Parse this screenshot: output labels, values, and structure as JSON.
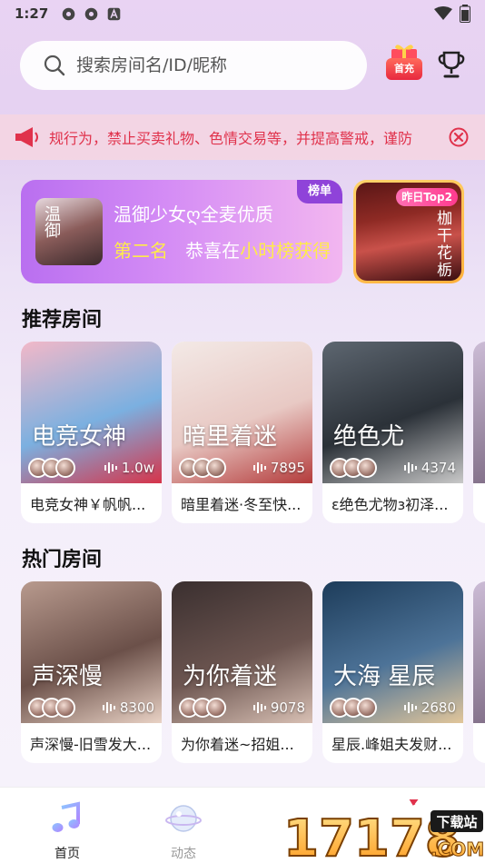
{
  "status": {
    "time": "1:27"
  },
  "search": {
    "placeholder": "搜索房间名/ID/昵称"
  },
  "header": {
    "first_recharge": "首充"
  },
  "notice": {
    "text": "规行为，禁止买卖礼物、色情交易等，并提高警戒，谨防"
  },
  "rank_banner": {
    "avatar_text": "温御",
    "line1": "温御少女ღ全麦优质",
    "line2_rank": "第二名",
    "line2_text": "恭喜在",
    "line2_highlight": "小时榜获得",
    "tag": "榜单"
  },
  "yesterday_top": {
    "tag": "昨日Top2",
    "name": "枷干花栃"
  },
  "recommended": {
    "title": "推荐房间",
    "rooms": [
      {
        "cover_title": "电竞女神",
        "count": "1.0w",
        "label": "电竞女神￥帆帆...",
        "colors": [
          "#f2b8c8",
          "#7bb0e0",
          "#d6344a"
        ]
      },
      {
        "cover_title": "暗里着迷",
        "count": "7895",
        "label": "暗里着迷·冬至快...",
        "colors": [
          "#f3e9e6",
          "#e8c9c4",
          "#b43b3b"
        ]
      },
      {
        "cover_title": "绝色尤",
        "count": "4374",
        "label": "ε绝色尤物з初泽...",
        "colors": [
          "#5d6670",
          "#2b3138",
          "#c9c9c9"
        ]
      }
    ]
  },
  "hot": {
    "title": "热门房间",
    "rooms": [
      {
        "cover_title": "声深慢",
        "count": "8300",
        "label": "声深慢-旧雪发大...",
        "colors": [
          "#b89a8e",
          "#6b5049",
          "#e9d2c5"
        ]
      },
      {
        "cover_title": "为你着迷",
        "count": "9078",
        "label": "为你着迷~招姐...",
        "colors": [
          "#3a2f2f",
          "#6c5550",
          "#d8c0b4"
        ]
      },
      {
        "cover_title": "大海 星辰",
        "count": "2680",
        "label": "星辰.峰姐夫发财...",
        "colors": [
          "#1d3c5a",
          "#4d7398",
          "#e2c69a"
        ]
      }
    ]
  },
  "tabbar": {
    "items": [
      {
        "label": "首页",
        "active": true
      },
      {
        "label": "动态",
        "active": false
      }
    ]
  },
  "watermark": {
    "number": "17178",
    "tag": "下载站",
    "suffix": ".COM"
  }
}
